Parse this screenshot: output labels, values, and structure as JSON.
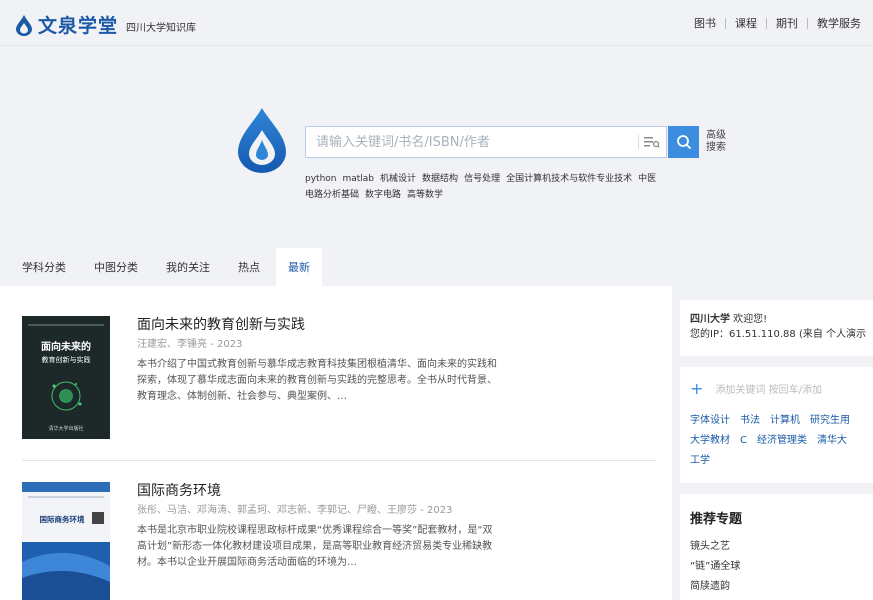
{
  "header": {
    "logo_text": "文泉学堂",
    "logo_sub": "四川大学知识库",
    "nav": [
      "图书",
      "课程",
      "期刊",
      "教学服务"
    ]
  },
  "search": {
    "placeholder": "请输入关键词/书名/ISBN/作者",
    "advanced_label": "高级搜索",
    "hot_words": [
      "python",
      "matlab",
      "机械设计",
      "数据结构",
      "信号处理",
      "全国计算机技术与软件专业技术",
      "中医",
      "电路分析基础",
      "数字电路",
      "高等数学"
    ]
  },
  "tabs": [
    "学科分类",
    "中图分类",
    "我的关注",
    "热点",
    "最新"
  ],
  "active_tab": "最新",
  "books": [
    {
      "title": "面向未来的教育创新与实践",
      "authors": "汪建宏、李锤亮 - 2023",
      "description": "本书介绍了中国式教育创新与慕华成志教育科技集团根植清华、面向未来的实践和探索，体现了慕华成志面向未来的教育创新与实践的完整思考。全书从时代背景、教育理念、体制创新、社会参与、典型案例、…",
      "cover_title_line1": "面向未来的",
      "cover_title_line2": "教育创新与实践",
      "cover_publisher": "清华大学出版社"
    },
    {
      "title": "国际商务环境",
      "authors": "张彤、马洁、邓海涛、郭孟珂、邓志新、李郭记、尸瞪、王廖莎 - 2023",
      "description": "本书是北京市职业院校课程思政标杆成果“优秀课程综合一等奖”配套教材，是“双高计划”新形态一体化教材建设项目成果，是高等职业教育经济贸易类专业稀缺教材。本书以企业开展国际商务活动面临的环境为…",
      "cover_title": "国际商务环境"
    }
  ],
  "sidebar": {
    "user_line1_bold": "四川大学",
    "user_line1_rest": " 欢迎您!",
    "user_line2": "您的IP：61.51.110.88 (来自 个人演示",
    "follow_placeholder": "添加关键词 按回车/添加",
    "follow_tags": [
      "字体设计",
      "书法",
      "计算机",
      "研究生用",
      "大学教材",
      "C",
      "经济管理类",
      "清华大",
      "工学"
    ],
    "topics_title": "推荐专题",
    "topics": [
      "镜头之艺",
      "“链”通全球",
      "简牍遗韵"
    ]
  },
  "colors": {
    "brand": "#1c5aa8",
    "accent": "#3c8de0",
    "page_bg": "#f1f2f5"
  }
}
